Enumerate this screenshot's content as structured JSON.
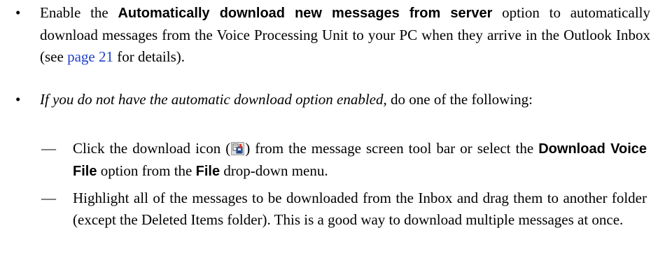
{
  "bullet1": {
    "pre": "Enable the ",
    "option_name": "Automatically download new messages from server",
    "mid": " option to automatically download messages from the Voice Processing Unit to your PC when they arrive in the Outlook Inbox (see ",
    "link": "page 21",
    "post": " for details)."
  },
  "bullet2": {
    "italic": "If you do not have the automatic download option enabled",
    "rest": ", do one of the following:"
  },
  "dash1": {
    "pre": "Click the download icon (",
    "icon": "download-voice-file-icon",
    "mid": ") from the message screen tool bar or select the ",
    "option_name": "Download Voice File",
    "mid2": " option from the ",
    "menu_name": "File",
    "post": " drop-down menu."
  },
  "dash2": {
    "text": "Highlight all of the messages to be downloaded from the Inbox and drag them to another folder (except the Deleted Items folder). This is a good way to download multiple messages at once."
  },
  "symbols": {
    "bullet": "•",
    "dash": "—"
  }
}
